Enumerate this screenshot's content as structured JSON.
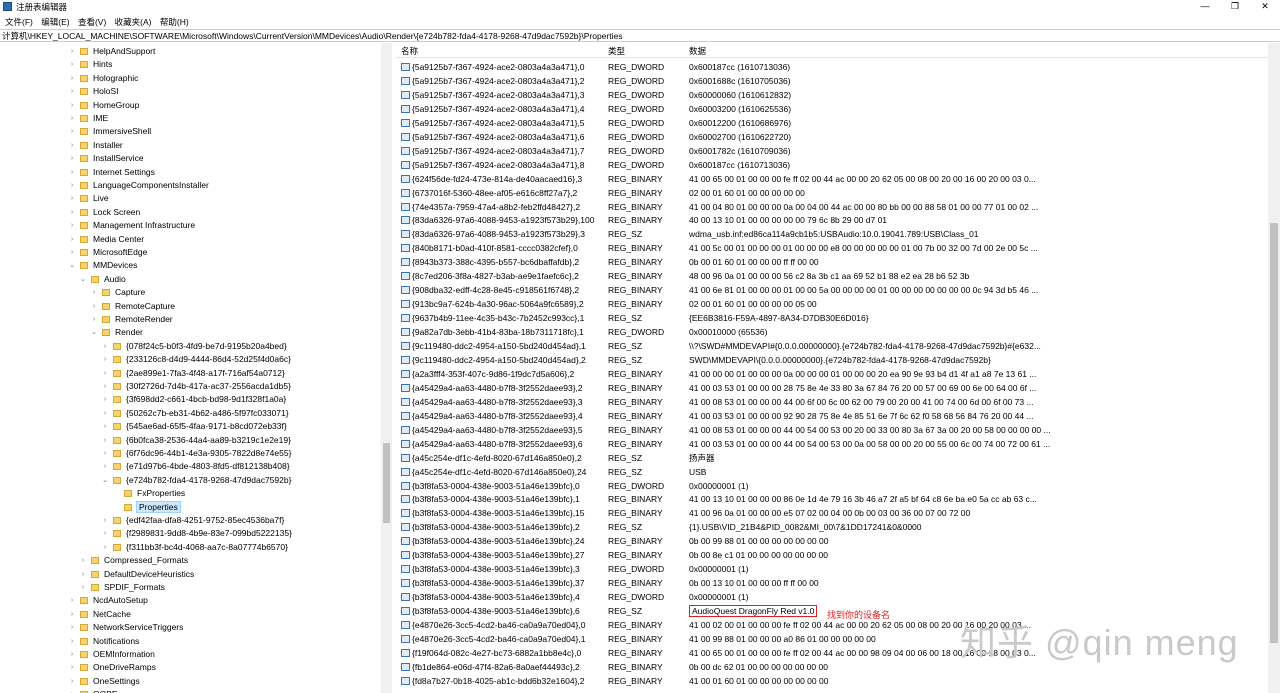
{
  "window": {
    "title": "注册表编辑器",
    "minimize": "—",
    "maximize": "❐",
    "close": "✕"
  },
  "menu": [
    "文件(F)",
    "编辑(E)",
    "查看(V)",
    "收藏夹(A)",
    "帮助(H)"
  ],
  "address": "计算机\\HKEY_LOCAL_MACHINE\\SOFTWARE\\Microsoft\\Windows\\CurrentVersion\\MMDevices\\Audio\\Render\\{e724b782-fda4-4178-9268-47d9dac7592b}\\Properties",
  "tree": [
    {
      "label": "HelpAndSupport",
      "level": 0,
      "arrow": "›"
    },
    {
      "label": "Hints",
      "level": 0,
      "arrow": "›"
    },
    {
      "label": "Holographic",
      "level": 0,
      "arrow": "›"
    },
    {
      "label": "HoloSI",
      "level": 0,
      "arrow": "›"
    },
    {
      "label": "HomeGroup",
      "level": 0,
      "arrow": "›"
    },
    {
      "label": "IME",
      "level": 0,
      "arrow": "›"
    },
    {
      "label": "ImmersiveShell",
      "level": 0,
      "arrow": "›"
    },
    {
      "label": "Installer",
      "level": 0,
      "arrow": "›"
    },
    {
      "label": "InstallService",
      "level": 0,
      "arrow": "›"
    },
    {
      "label": "Internet Settings",
      "level": 0,
      "arrow": "›"
    },
    {
      "label": "LanguageComponentsInstaller",
      "level": 0,
      "arrow": "›"
    },
    {
      "label": "Live",
      "level": 0,
      "arrow": "›"
    },
    {
      "label": "Lock Screen",
      "level": 0,
      "arrow": "›"
    },
    {
      "label": "Management Infrastructure",
      "level": 0,
      "arrow": "›"
    },
    {
      "label": "Media Center",
      "level": 0,
      "arrow": "›"
    },
    {
      "label": "MicrosoftEdge",
      "level": 0,
      "arrow": "›"
    },
    {
      "label": "MMDevices",
      "level": 0,
      "arrow": "⌄"
    },
    {
      "label": "Audio",
      "level": 1,
      "arrow": "⌄"
    },
    {
      "label": "Capture",
      "level": 2,
      "arrow": "›"
    },
    {
      "label": "RemoteCapture",
      "level": 2,
      "arrow": "›"
    },
    {
      "label": "RemoteRender",
      "level": 2,
      "arrow": "›"
    },
    {
      "label": "Render",
      "level": 2,
      "arrow": "⌄"
    },
    {
      "label": "{078f24c5-b0f3-4fd9-be7d-9195b20a4bed}",
      "level": 3,
      "arrow": "›"
    },
    {
      "label": "{233126c8-d4d9-4444-86d4-52d25f4d0a6c}",
      "level": 3,
      "arrow": "›"
    },
    {
      "label": "{2ae899e1-7fa3-4f48-a17f-716af54a0712}",
      "level": 3,
      "arrow": "›"
    },
    {
      "label": "{30f2726d-7d4b-417a-ac37-2556acda1db5}",
      "level": 3,
      "arrow": "›"
    },
    {
      "label": "{3f698dd2-c661-4bcb-bd98-9d1f328f1a0a}",
      "level": 3,
      "arrow": "›"
    },
    {
      "label": "{50262c7b-eb31-4b62-a486-5f97fc033071}",
      "level": 3,
      "arrow": "›"
    },
    {
      "label": "{545ae6ad-65f5-4faa-9171-b8cd072eb33f}",
      "level": 3,
      "arrow": "›"
    },
    {
      "label": "{6b0fca38-2536-44a4-aa89-b3219c1e2e19}",
      "level": 3,
      "arrow": "›"
    },
    {
      "label": "{6f76dc96-44b1-4e3a-9305-7822d8e74e55}",
      "level": 3,
      "arrow": "›"
    },
    {
      "label": "{e71d97b6-4bde-4803-8fd5-df812138b408}",
      "level": 3,
      "arrow": "›"
    },
    {
      "label": "{e724b782-fda4-4178-9268-47d9dac7592b}",
      "level": 3,
      "arrow": "⌄"
    },
    {
      "label": "FxProperties",
      "level": 4,
      "arrow": ""
    },
    {
      "label": "Properties",
      "level": 4,
      "arrow": "",
      "selected": true
    },
    {
      "label": "{edf42faa-dfa8-4251-9752-85ec4536ba7f}",
      "level": 3,
      "arrow": "›"
    },
    {
      "label": "{f2989831-9dd8-4b9e-83e7-099bd5222135}",
      "level": 3,
      "arrow": "›"
    },
    {
      "label": "{f311bb3f-bc4d-4068-aa7c-8a07774b6570}",
      "level": 3,
      "arrow": "›"
    },
    {
      "label": "Compressed_Formats",
      "level": 1,
      "arrow": "›"
    },
    {
      "label": "DefaultDeviceHeuristics",
      "level": 1,
      "arrow": "›"
    },
    {
      "label": "SPDIF_Formats",
      "level": 1,
      "arrow": "›"
    },
    {
      "label": "NcdAutoSetup",
      "level": 0,
      "arrow": "›"
    },
    {
      "label": "NetCache",
      "level": 0,
      "arrow": "›"
    },
    {
      "label": "NetworkServiceTriggers",
      "level": 0,
      "arrow": "›"
    },
    {
      "label": "Notifications",
      "level": 0,
      "arrow": "›"
    },
    {
      "label": "OEMInformation",
      "level": 0,
      "arrow": "›"
    },
    {
      "label": "OneDriveRamps",
      "level": 0,
      "arrow": "›"
    },
    {
      "label": "OneSettings",
      "level": 0,
      "arrow": "›"
    },
    {
      "label": "OOBE",
      "level": 0,
      "arrow": "›"
    }
  ],
  "columns": {
    "name": "名称",
    "type": "类型",
    "data": "数据"
  },
  "values": [
    {
      "name": "{5a9125b7-f367-4924-ace2-0803a4a3a471},0",
      "type": "REG_DWORD",
      "data": "0x600187cc (1610713036)"
    },
    {
      "name": "{5a9125b7-f367-4924-ace2-0803a4a3a471},2",
      "type": "REG_DWORD",
      "data": "0x6001688c (1610705036)"
    },
    {
      "name": "{5a9125b7-f367-4924-ace2-0803a4a3a471},3",
      "type": "REG_DWORD",
      "data": "0x60000060 (1610612832)"
    },
    {
      "name": "{5a9125b7-f367-4924-ace2-0803a4a3a471},4",
      "type": "REG_DWORD",
      "data": "0x60003200 (1610625536)"
    },
    {
      "name": "{5a9125b7-f367-4924-ace2-0803a4a3a471},5",
      "type": "REG_DWORD",
      "data": "0x60012200 (1610686976)"
    },
    {
      "name": "{5a9125b7-f367-4924-ace2-0803a4a3a471},6",
      "type": "REG_DWORD",
      "data": "0x60002700 (1610622720)"
    },
    {
      "name": "{5a9125b7-f367-4924-ace2-0803a4a3a471},7",
      "type": "REG_DWORD",
      "data": "0x6001782c (1610709036)"
    },
    {
      "name": "{5a9125b7-f367-4924-ace2-0803a4a3a471},8",
      "type": "REG_DWORD",
      "data": "0x600187cc (1610713036)"
    },
    {
      "name": "{624f56de-fd24-473e-814a-de40aacaed16},3",
      "type": "REG_BINARY",
      "data": "41 00 65 00 01 00 00 00 fe ff 02 00 44 ac 00 00 20 62 05 00 08 00 20 00 16 00 20 00 03 0..."
    },
    {
      "name": "{6737016f-5360-48ee-af05-e616c8ff27a7},2",
      "type": "REG_BINARY",
      "data": "02 00 01 60 01 00 00 00 00 00"
    },
    {
      "name": "{74e4357a-7959-47a4-a8b2-feb2ffd48427},2",
      "type": "REG_BINARY",
      "data": "41 00 04 80 01 00 00 00 0a 00 04 00 44 ac 00 00 80 bb 00 00 88 58 01 00 00 77 01 00 02 ..."
    },
    {
      "name": "{83da6326-97a6-4088-9453-a1923f573b29},100",
      "type": "REG_BINARY",
      "data": "40 00 13 10 01 00 00 00 00 00 79 6c 8b 29 00 d7 01"
    },
    {
      "name": "{83da6326-97a6-4088-9453-a1923f573b29},3",
      "type": "REG_SZ",
      "data": "wdma_usb.inf:ed86ca114a9cb1b5:USBAudio:10.0.19041.789:USB\\Class_01"
    },
    {
      "name": "{840b8171-b0ad-410f-8581-cccc0382cfef},0",
      "type": "REG_BINARY",
      "data": "41 00 5c 00 01 00 00 00 01 00 00 00 e8 00 00 00 00 00 01 00 7b 00 32 00 7d 00 2e 00 5c ..."
    },
    {
      "name": "{8943b373-388c-4395-b557-bc6dbaffafdb},2",
      "type": "REG_BINARY",
      "data": "0b 00 01 60 01 00 00 00 ff ff 00 00"
    },
    {
      "name": "{8c7ed206-3f8a-4827-b3ab-ae9e1faefc6c},2",
      "type": "REG_BINARY",
      "data": "48 00 96 0a 01 00 00 00 56 c2 8a 3b c1 aa 69 52 b1 88 e2 ea 28 b6 52 3b"
    },
    {
      "name": "{908dba32-edff-4c28-8e45-c918561f6748},2",
      "type": "REG_BINARY",
      "data": "41 00 6e 81 01 00 00 00 01 00 00 5a 00 00 00 00 01 00 00 00 00 00 00 00 0c 94 3d b5 46 ..."
    },
    {
      "name": "{913bc9a7-624b-4a30-96ac-5064a9fc6589},2",
      "type": "REG_BINARY",
      "data": "02 00 01 60 01 00 00 00 00 05 00"
    },
    {
      "name": "{9637b4b9-11ee-4c35-b43c-7b2452c993cc},1",
      "type": "REG_SZ",
      "data": "{EE6B3816-F59A-4897-8A34-D7DB30E6D016}"
    },
    {
      "name": "{9a82a7db-3ebb-41b4-83ba-18b7311718fc},1",
      "type": "REG_DWORD",
      "data": "0x00010000 (65536)"
    },
    {
      "name": "{9c119480-ddc2-4954-a150-5bd240d454ad},1",
      "type": "REG_SZ",
      "data": "\\\\?\\SWD#MMDEVAPI#{0.0.0.00000000}.{e724b782-fda4-4178-9268-47d9dac7592b}#{e632..."
    },
    {
      "name": "{9c119480-ddc2-4954-a150-5bd240d454ad},2",
      "type": "REG_SZ",
      "data": "SWD\\MMDEVAPI\\{0.0.0.00000000}.{e724b782-fda4-4178-9268-47d9dac7592b}"
    },
    {
      "name": "{a2a3fff4-353f-407c-9d86-1f9dc7d5a606},2",
      "type": "REG_BINARY",
      "data": "41 00 00 00 01 00 00 00 0a 00 00 00 01 00 00 00 20 ea 90 9e 93 b4 d1 4f a1 a8 7e 13 61 ..."
    },
    {
      "name": "{a45429a4-aa63-4480-b7f8-3f2552daee93},2",
      "type": "REG_BINARY",
      "data": "41 00 03 53 01 00 00 00 28 75 8e 4e 33 80 3a 67 84 76 20 00 57 00 69 00 6e 00 64 00 6f ..."
    },
    {
      "name": "{a45429a4-aa63-4480-b7f8-3f2552daee93},3",
      "type": "REG_BINARY",
      "data": "41 00 08 53 01 00 00 00 44 00 6f 00 6c 00 62 00 79 00 20 00 41 00 74 00 6d 00 6f 00 73 ..."
    },
    {
      "name": "{a45429a4-aa63-4480-b7f8-3f2552daee93},4",
      "type": "REG_BINARY",
      "data": "41 00 03 53 01 00 00 00 92 90 28 75 8e 4e 85 51 6e 7f 6c 62 f0 58 68 56 84 76 20 00 44 ..."
    },
    {
      "name": "{a45429a4-aa63-4480-b7f8-3f2552daee93},5",
      "type": "REG_BINARY",
      "data": "41 00 08 53 01 00 00 00 44 00 54 00 53 00 20 00 33 00 80 3a 67 3a 00 20 00 58 00 00 00 00 ..."
    },
    {
      "name": "{a45429a4-aa63-4480-b7f8-3f2552daee93},6",
      "type": "REG_BINARY",
      "data": "41 00 03 53 01 00 00 00 44 00 54 00 53 00 0a 00 58 00 00 20 00 55 00 6c 00 74 00 72 00 61 ..."
    },
    {
      "name": "{a45c254e-df1c-4efd-8020-67d146a850e0},2",
      "type": "REG_SZ",
      "data": "扬声器"
    },
    {
      "name": "{a45c254e-df1c-4efd-8020-67d146a850e0},24",
      "type": "REG_SZ",
      "data": "USB"
    },
    {
      "name": "{b3f8fa53-0004-438e-9003-51a46e139bfc},0",
      "type": "REG_DWORD",
      "data": "0x00000001 (1)"
    },
    {
      "name": "{b3f8fa53-0004-438e-9003-51a46e139bfc},1",
      "type": "REG_BINARY",
      "data": "41 00 13 10 01 00 00 00 86 0e 1d 4e 79 16 3b 46 a7 2f a5 bf 64 c8 6e ba e0 5a cc ab 63 c..."
    },
    {
      "name": "{b3f8fa53-0004-438e-9003-51a46e139bfc},15",
      "type": "REG_BINARY",
      "data": "41 00 96 0a 01 00 00 00 e5 07 02 00 04 00 0b 00 03 00 36 00 07 00 72 00"
    },
    {
      "name": "{b3f8fa53-0004-438e-9003-51a46e139bfc},2",
      "type": "REG_SZ",
      "data": "{1}.USB\\VID_21B4&PID_0082&MI_00\\7&1DD17241&0&0000"
    },
    {
      "name": "{b3f8fa53-0004-438e-9003-51a46e139bfc},24",
      "type": "REG_BINARY",
      "data": "0b 00 99 88 01 00 00 00 00 00 00 00"
    },
    {
      "name": "{b3f8fa53-0004-438e-9003-51a46e139bfc},27",
      "type": "REG_BINARY",
      "data": "0b 00 8e c1 01 00 00 00 00 00 00 00"
    },
    {
      "name": "{b3f8fa53-0004-438e-9003-51a46e139bfc},3",
      "type": "REG_DWORD",
      "data": "0x00000001 (1)"
    },
    {
      "name": "{b3f8fa53-0004-438e-9003-51a46e139bfc},37",
      "type": "REG_BINARY",
      "data": "0b 00 13 10 01 00 00 00 ff ff 00 00"
    },
    {
      "name": "{b3f8fa53-0004-438e-9003-51a46e139bfc},4",
      "type": "REG_DWORD",
      "data": "0x00000001 (1)"
    },
    {
      "name": "{b3f8fa53-0004-438e-9003-51a46e139bfc},6",
      "type": "REG_SZ",
      "data": "AudioQuest DragonFly Red v1.0",
      "highlight": true
    },
    {
      "name": "{e4870e26-3cc5-4cd2-ba46-ca0a9a70ed04},0",
      "type": "REG_BINARY",
      "data": "41 00 02 00 01 00 00 00 fe ff 02 00 44 ac 00 00 20 62 05 00 08 00 20 00 16 00 20 00 03 ..."
    },
    {
      "name": "{e4870e26-3cc5-4cd2-ba46-ca0a9a70ed04},1",
      "type": "REG_BINARY",
      "data": "41 00 99 88 01 00 00 00 a0 86 01 00 00 00 00 00"
    },
    {
      "name": "{f19f064d-082c-4e27-bc73-6882a1bb8e4c},0",
      "type": "REG_BINARY",
      "data": "41 00 65 00 01 00 00 00 fe ff 02 00 44 ac 00 00 98 09 04 00 06 00 18 00 16 00 18 00 03 0..."
    },
    {
      "name": "{fb1de864-e06d-47f4-82a6-8a0aef44493c},2",
      "type": "REG_BINARY",
      "data": "0b 00 dc 62 01 00 00 00 00 00 00 00"
    },
    {
      "name": "{fd8a7b27-0b18-4025-ab1c-bdd6b32e1604},2",
      "type": "REG_BINARY",
      "data": "41 00 01 60 01 00 00 00 00 00 00 00"
    }
  ],
  "annotation": "找到你的设备名",
  "watermark": "知乎 @qin meng"
}
